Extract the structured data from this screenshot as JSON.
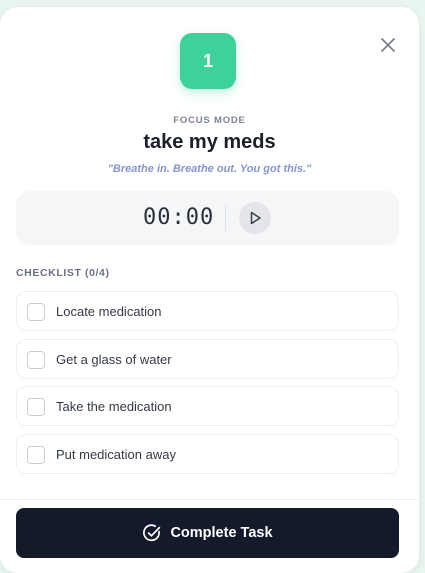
{
  "modal": {
    "badge_number": "1",
    "mode_label": "FOCUS MODE",
    "task_title": "take my meds",
    "quote": "\"Breathe in. Breathe out. You got this.\""
  },
  "timer": {
    "display": "00:00"
  },
  "checklist": {
    "header": "CHECKLIST (0/4)",
    "items": [
      {
        "label": "Locate medication",
        "checked": false
      },
      {
        "label": "Get a glass of water",
        "checked": false
      },
      {
        "label": "Take the medication",
        "checked": false
      },
      {
        "label": "Put medication away",
        "checked": false
      }
    ]
  },
  "footer": {
    "complete_label": "Complete Task"
  },
  "colors": {
    "accent": "#3fd19a",
    "button_dark": "#141a2c",
    "quote": "#8594d4"
  },
  "icons": {
    "close": "close-icon",
    "play": "play-icon",
    "complete": "check-circle-icon"
  }
}
